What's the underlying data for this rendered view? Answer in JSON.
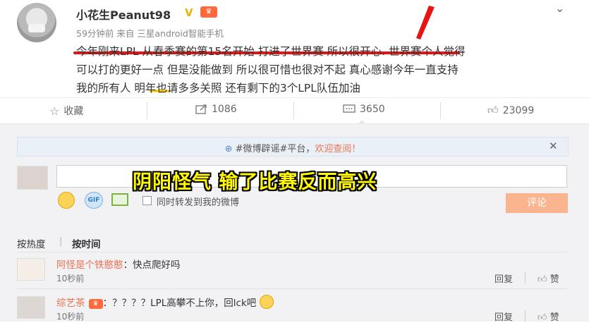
{
  "post": {
    "username": "小花生Peanut98",
    "badge_v": "V",
    "time": "59分钟前",
    "via_label": "来自",
    "device": "三星android智能手机",
    "lines": [
      "今年刚来LPL 从春季赛的第15名开始 打进了世界赛 所以很开心. 世界赛个人觉得",
      "可以打的更好一点 但是没能做到 所以很可惜也很对不起 真心感谢今年一直支持",
      "我的所有人  明年也请多多关照 还有剩下的3个LPL队伍加油"
    ]
  },
  "actions": {
    "favorite": "收藏",
    "repost": "1086",
    "comment": "3650",
    "like": "23099"
  },
  "comment_panel": {
    "notice_prefix": "#微博辟谣#平台，",
    "notice_highlight": "欢迎查阅！",
    "overlay_caption": "阴阳怪气   输了比赛反而高兴",
    "gif_label": "GIF",
    "repost_checkbox_label": "同时转发到我的微博",
    "submit_label": "评论",
    "sort_hot": "按热度",
    "sort_time": "按时间"
  },
  "comments": [
    {
      "name": "阿怪是个铁憨憨",
      "text": "：快点爬好吗",
      "time": "10秒前",
      "reply": "回复",
      "like": "赞"
    },
    {
      "name": "综艺茶",
      "text": "：？？？？LPL高攀不上你，回lck吧",
      "time": "10秒前",
      "reply": "回复",
      "like": "赞"
    }
  ],
  "colors": {
    "accent_orange": "#eb7350",
    "annotation_red": "#e81414",
    "overlay_yellow": "#fff800"
  },
  "icons": [
    "caret-down-icon",
    "star-icon",
    "repost-icon",
    "comment-icon",
    "thumbs-up-icon",
    "close-icon",
    "emoji-icon",
    "gif-icon",
    "image-icon"
  ]
}
